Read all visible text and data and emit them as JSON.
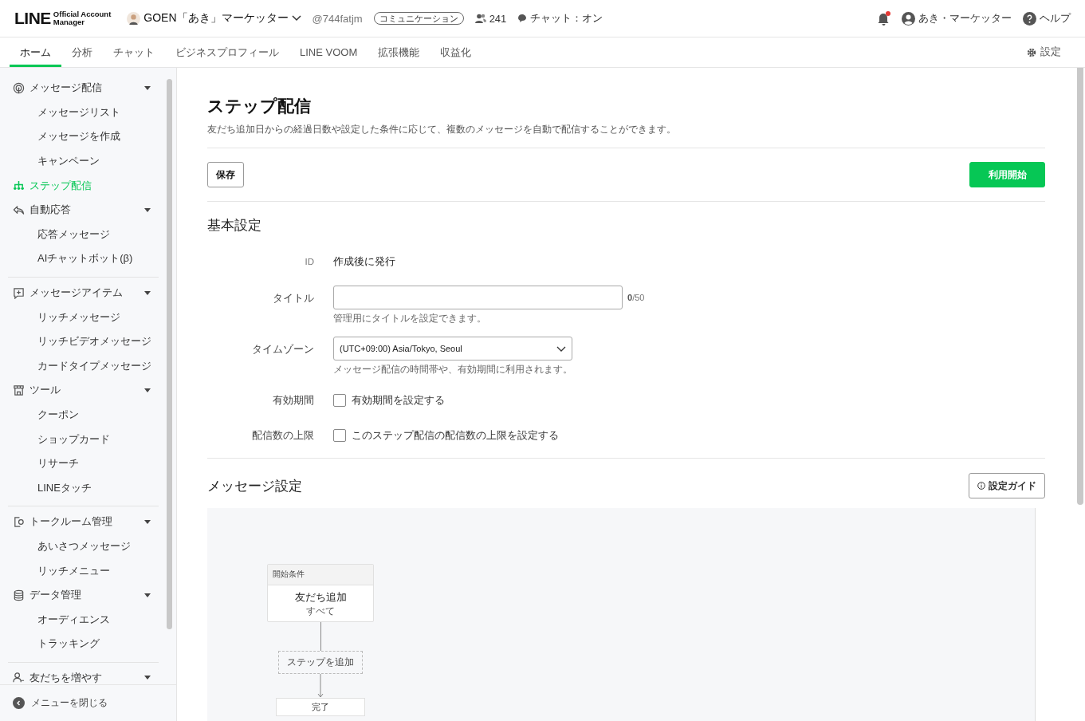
{
  "header": {
    "logo": {
      "wordmark": "LINE",
      "line1": "Official Account",
      "line2": "Manager"
    },
    "account": {
      "name": "GOEN「あき」マーケッター",
      "handle": "@744fatjm",
      "plan_badge": "コミュニケーション",
      "friends": "241",
      "chat_status": "チャット：オン"
    },
    "notifications": {
      "unread": true
    },
    "user": "あき・マーケッター",
    "help": "ヘルプ"
  },
  "tabs": [
    {
      "label": "ホーム",
      "selected": true
    },
    {
      "label": "分析",
      "selected": false
    },
    {
      "label": "チャット",
      "selected": false
    },
    {
      "label": "ビジネスプロフィール",
      "selected": false
    },
    {
      "label": "LINE VOOM",
      "selected": false
    },
    {
      "label": "拡張機能",
      "selected": false
    },
    {
      "label": "収益化",
      "selected": false
    }
  ],
  "settings_link": "設定",
  "sidebar": {
    "sections": [
      [
        {
          "label": "メッセージ配信",
          "selected": false,
          "expanded": true,
          "children": [
            {
              "label": "メッセージリスト",
              "selected": false
            },
            {
              "label": "メッセージを作成",
              "selected": false
            },
            {
              "label": "キャンペーン",
              "selected": false
            }
          ]
        },
        {
          "label": "ステップ配信",
          "selected": true
        },
        {
          "label": "自動応答",
          "selected": false,
          "expanded": true,
          "children": [
            {
              "label": "応答メッセージ",
              "selected": false
            },
            {
              "label": "AIチャットボット(β)",
              "selected": false
            }
          ]
        }
      ],
      [
        {
          "label": "メッセージアイテム",
          "selected": false,
          "expanded": true,
          "children": [
            {
              "label": "リッチメッセージ",
              "selected": false
            },
            {
              "label": "リッチビデオメッセージ",
              "selected": false
            },
            {
              "label": "カードタイプメッセージ",
              "selected": false
            }
          ]
        },
        {
          "label": "ツール",
          "selected": false,
          "expanded": true,
          "children": [
            {
              "label": "クーポン",
              "selected": false
            },
            {
              "label": "ショップカード",
              "selected": false
            },
            {
              "label": "リサーチ",
              "selected": false
            },
            {
              "label": "LINEタッチ",
              "selected": false
            }
          ]
        }
      ],
      [
        {
          "label": "トークルーム管理",
          "selected": false,
          "expanded": true,
          "children": [
            {
              "label": "あいさつメッセージ",
              "selected": false
            },
            {
              "label": "リッチメニュー",
              "selected": false
            }
          ]
        },
        {
          "label": "データ管理",
          "selected": false,
          "expanded": true,
          "children": [
            {
              "label": "オーディエンス",
              "selected": false
            },
            {
              "label": "トラッキング",
              "selected": false
            }
          ]
        }
      ],
      [
        {
          "label": "友だちを増やす",
          "selected": false,
          "expanded": true
        }
      ]
    ],
    "close_menu": "メニューを閉じる"
  },
  "page": {
    "title": "ステップ配信",
    "description": "友だち追加日からの経過日数や設定した条件に応じて、複数のメッセージを自動で配信することができます。",
    "save_button": "保存",
    "start_button": "利用開始"
  },
  "basic_settings": {
    "heading": "基本設定",
    "rows": [
      {
        "kind": "text",
        "label": "ID",
        "value": "作成後に発行"
      },
      {
        "kind": "input",
        "label": "タイトル",
        "value": "",
        "counter_current": "0",
        "counter_max": "/50",
        "hint": "管理用にタイトルを設定できます。"
      },
      {
        "kind": "select",
        "label": "タイムゾーン",
        "value": "(UTC+09:00) Asia/Tokyo, Seoul",
        "hint": "メッセージ配信の時間帯や、有効期間に利用されます。"
      },
      {
        "kind": "checkbox",
        "label": "有効期間",
        "option": "有効期間を設定する",
        "checked": false
      },
      {
        "kind": "checkbox",
        "label": "配信数の上限",
        "option": "このステップ配信の配信数の上限を設定する",
        "checked": false
      }
    ]
  },
  "message_settings": {
    "heading": "メッセージ設定",
    "guide_button": "設定ガイド",
    "flow": {
      "start": {
        "header": "開始条件",
        "title": "友だち追加",
        "subtitle": "すべて"
      },
      "add_step": "ステップを追加",
      "end": "完了"
    }
  }
}
